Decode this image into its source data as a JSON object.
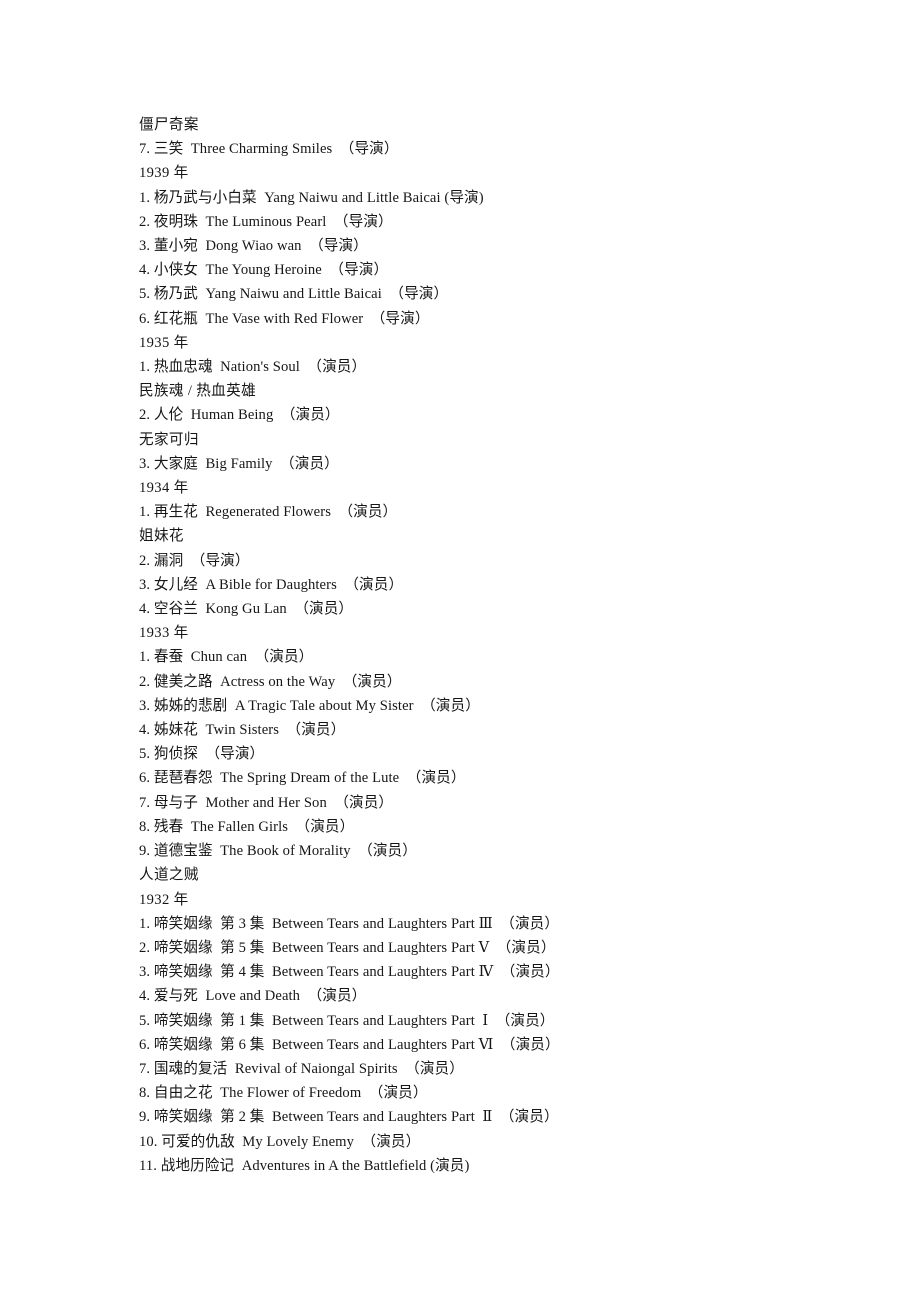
{
  "document": {
    "type": "filmography-list",
    "lines": [
      {
        "id": "alt-title-jiangshi",
        "kind": "alt-title",
        "text": "僵尸奇案"
      },
      {
        "id": "entry-1941-7",
        "kind": "entry",
        "text": "7. 三笑  Three Charming Smiles  （导演）"
      },
      {
        "id": "year-1939",
        "kind": "year",
        "text": "1939 年"
      },
      {
        "id": "entry-1939-1",
        "kind": "entry",
        "text": "1. 杨乃武与小白菜  Yang Naiwu and Little Baicai (导演)"
      },
      {
        "id": "entry-1939-2",
        "kind": "entry",
        "text": "2. 夜明珠  The Luminous Pearl  （导演）"
      },
      {
        "id": "entry-1939-3",
        "kind": "entry",
        "text": "3. 董小宛  Dong Wiao wan  （导演）"
      },
      {
        "id": "entry-1939-4",
        "kind": "entry",
        "text": "4. 小侠女  The Young Heroine  （导演）"
      },
      {
        "id": "entry-1939-5",
        "kind": "entry",
        "text": "5. 杨乃武  Yang Naiwu and Little Baicai  （导演）"
      },
      {
        "id": "entry-1939-6",
        "kind": "entry",
        "text": "6. 红花瓶  The Vase with Red Flower  （导演）"
      },
      {
        "id": "year-1935",
        "kind": "year",
        "text": "1935 年"
      },
      {
        "id": "entry-1935-1",
        "kind": "entry",
        "text": "1. 热血忠魂  Nation's Soul  （演员）"
      },
      {
        "id": "alt-title-minzuhun",
        "kind": "alt-title",
        "text": "民族魂 / 热血英雄"
      },
      {
        "id": "entry-1935-2",
        "kind": "entry",
        "text": "2. 人伦  Human Being  （演员）"
      },
      {
        "id": "alt-title-wujiakegui",
        "kind": "alt-title",
        "text": "无家可归"
      },
      {
        "id": "entry-1935-3",
        "kind": "entry",
        "text": "3. 大家庭  Big Family  （演员）"
      },
      {
        "id": "year-1934",
        "kind": "year",
        "text": "1934 年"
      },
      {
        "id": "entry-1934-1",
        "kind": "entry",
        "text": "1. 再生花  Regenerated Flowers  （演员）"
      },
      {
        "id": "alt-title-jiemeihua",
        "kind": "alt-title",
        "text": "姐妹花"
      },
      {
        "id": "entry-1934-2",
        "kind": "entry",
        "text": "2. 漏洞  （导演）"
      },
      {
        "id": "entry-1934-3",
        "kind": "entry",
        "text": "3. 女儿经  A Bible for Daughters  （演员）"
      },
      {
        "id": "entry-1934-4",
        "kind": "entry",
        "text": "4. 空谷兰  Kong Gu Lan  （演员）"
      },
      {
        "id": "year-1933",
        "kind": "year",
        "text": "1933 年"
      },
      {
        "id": "entry-1933-1",
        "kind": "entry",
        "text": "1. 春蚕  Chun can  （演员）"
      },
      {
        "id": "entry-1933-2",
        "kind": "entry",
        "text": "2. 健美之路  Actress on the Way  （演员）"
      },
      {
        "id": "entry-1933-3",
        "kind": "entry",
        "text": "3. 姊姊的悲剧  A Tragic Tale about My Sister  （演员）"
      },
      {
        "id": "entry-1933-4",
        "kind": "entry",
        "text": "4. 姊妹花  Twin Sisters  （演员）"
      },
      {
        "id": "entry-1933-5",
        "kind": "entry",
        "text": "5. 狗侦探  （导演）"
      },
      {
        "id": "entry-1933-6",
        "kind": "entry",
        "text": "6. 琵琶春怨  The Spring Dream of the Lute  （演员）"
      },
      {
        "id": "entry-1933-7",
        "kind": "entry",
        "text": "7. 母与子  Mother and Her Son  （演员）"
      },
      {
        "id": "entry-1933-8",
        "kind": "entry",
        "text": "8. 残春  The Fallen Girls  （演员）"
      },
      {
        "id": "entry-1933-9",
        "kind": "entry",
        "text": "9. 道德宝鉴  The Book of Morality  （演员）"
      },
      {
        "id": "alt-title-rendaozhizei",
        "kind": "alt-title",
        "text": "人道之贼"
      },
      {
        "id": "year-1932",
        "kind": "year",
        "text": "1932 年"
      },
      {
        "id": "entry-1932-1",
        "kind": "entry",
        "text": "1. 啼笑姻缘  第 3 集  Between Tears and Laughters Part Ⅲ  （演员）"
      },
      {
        "id": "entry-1932-2",
        "kind": "entry",
        "text": "2. 啼笑姻缘  第 5 集  Between Tears and Laughters Part Ⅴ  （演员）"
      },
      {
        "id": "entry-1932-3",
        "kind": "entry",
        "text": "3. 啼笑姻缘  第 4 集  Between Tears and Laughters Part Ⅳ  （演员）"
      },
      {
        "id": "entry-1932-4",
        "kind": "entry",
        "text": "4. 爱与死  Love and Death  （演员）"
      },
      {
        "id": "entry-1932-5",
        "kind": "entry",
        "text": "5. 啼笑姻缘  第 1 集  Between Tears and Laughters Part  Ⅰ  （演员）"
      },
      {
        "id": "entry-1932-6",
        "kind": "entry",
        "text": "6. 啼笑姻缘  第 6 集  Between Tears and Laughters Part Ⅵ  （演员）"
      },
      {
        "id": "entry-1932-7",
        "kind": "entry",
        "text": "7. 国魂的复活  Revival of Naiongal Spirits  （演员）"
      },
      {
        "id": "entry-1932-8",
        "kind": "entry",
        "text": "8. 自由之花  The Flower of Freedom  （演员）"
      },
      {
        "id": "entry-1932-9",
        "kind": "entry",
        "text": "9. 啼笑姻缘  第 2 集  Between Tears and Laughters Part  Ⅱ  （演员）"
      },
      {
        "id": "entry-1932-10",
        "kind": "entry",
        "text": "10. 可爱的仇敌  My Lovely Enemy  （演员）"
      },
      {
        "id": "entry-1932-11",
        "kind": "entry",
        "text": "11. 战地历险记  Adventures in A the Battlefield (演员)"
      }
    ]
  }
}
